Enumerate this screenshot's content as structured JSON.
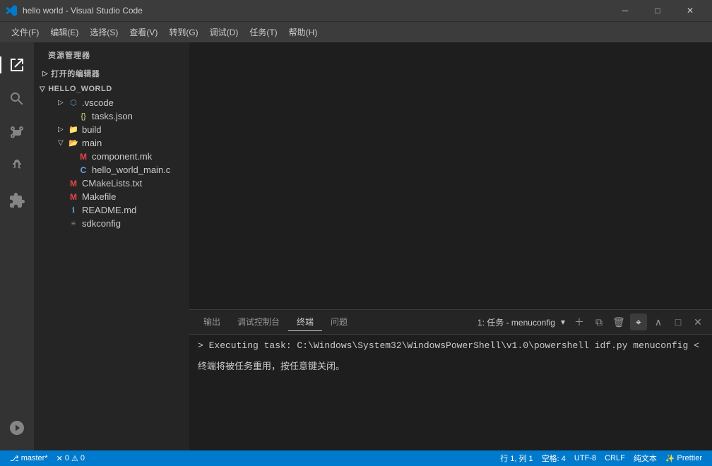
{
  "titlebar": {
    "icon": "vscode-icon",
    "title": "hello world - Visual Studio Code",
    "minimize": "─",
    "maximize": "□",
    "close": "✕"
  },
  "menubar": {
    "items": [
      "文件(F)",
      "编辑(E)",
      "选择(S)",
      "查看(V)",
      "转到(G)",
      "调试(D)",
      "任务(T)",
      "帮助(H)"
    ]
  },
  "sidebar": {
    "header": "资源管理器",
    "openEditors": "打开的编辑器",
    "projectName": "HELLO_WORLD",
    "tree": [
      {
        "label": ".vscode",
        "indent": 2,
        "type": "folder-closed",
        "icon": "folder"
      },
      {
        "label": "tasks.json",
        "indent": 3,
        "type": "file",
        "icon": "json"
      },
      {
        "label": "build",
        "indent": 2,
        "type": "folder-closed",
        "icon": "folder"
      },
      {
        "label": "main",
        "indent": 2,
        "type": "folder-open",
        "icon": "folder"
      },
      {
        "label": "component.mk",
        "indent": 3,
        "type": "file",
        "icon": "m"
      },
      {
        "label": "hello_world_main.c",
        "indent": 3,
        "type": "file",
        "icon": "c"
      },
      {
        "label": "CMakeLists.txt",
        "indent": 2,
        "type": "file",
        "icon": "m"
      },
      {
        "label": "Makefile",
        "indent": 2,
        "type": "file",
        "icon": "m"
      },
      {
        "label": "README.md",
        "indent": 2,
        "type": "file",
        "icon": "info"
      },
      {
        "label": "sdkconfig",
        "indent": 2,
        "type": "file",
        "icon": "list"
      }
    ]
  },
  "terminal": {
    "tabs": [
      "输出",
      "调试控制台",
      "终端",
      "问题"
    ],
    "activeTab": "终端",
    "title": "1: 任务 - menuconfig",
    "dropdownIcon": "▾",
    "controls": [
      "+",
      "⊞",
      "🗑",
      "⌃",
      "^",
      "□",
      "✕"
    ],
    "commandLine": "> Executing task: C:\\Windows\\System32\\WindowsPowerShell\\v1.0\\powershell idf.py menuconfig <",
    "closingNote": "终端将被任务重用，按任意键关闭。"
  },
  "statusbar": {
    "left": [
      "⎇ master*",
      "⚠ 0",
      "✕ 0"
    ],
    "right": [
      "行 1, 列 1",
      "空格: 4",
      "UTF-8",
      "CRLF",
      "纯文本",
      "Prettier"
    ]
  },
  "activityBar": {
    "icons": [
      {
        "name": "explorer",
        "symbol": "📄",
        "active": true
      },
      {
        "name": "search",
        "symbol": "🔍",
        "active": false
      },
      {
        "name": "source-control",
        "symbol": "⎇",
        "active": false
      },
      {
        "name": "debug",
        "symbol": "▶",
        "active": false
      },
      {
        "name": "extensions",
        "symbol": "⊞",
        "active": false
      },
      {
        "name": "remote",
        "symbol": "⌂",
        "active": false
      }
    ]
  }
}
